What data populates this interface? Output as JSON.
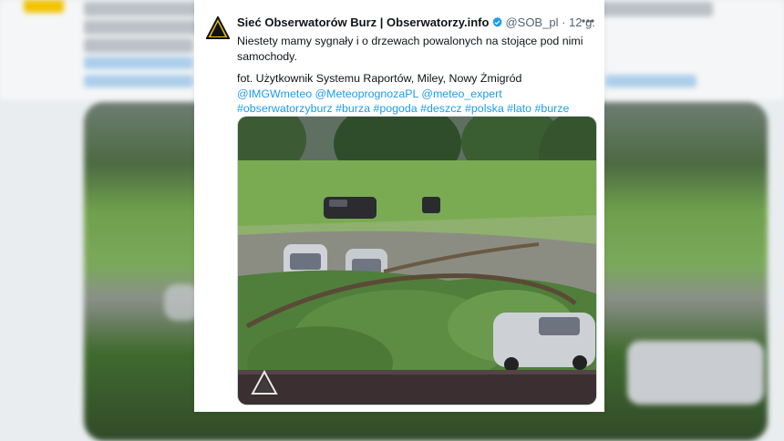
{
  "background": {
    "headline_visible": "Niestety mamy sygnały i o drzewach powalonych na stojące pod nimi samochody."
  },
  "tweet": {
    "author_name": "Sieć Obserwatorów Burz | Obserwatorzy.info",
    "handle": "@SOB_pl",
    "separator": "·",
    "time": "12 g.",
    "more_icon": "more-icon",
    "text_line1": "Niestety mamy sygnały i o drzewach powalonych na stojące pod nimi samochody.",
    "text_line2": "fot. Użytkownik Systemu Raportów, Miley, Nowy Żmigród",
    "mentions": "@IMGWmeteo @MeteoprognozaPL @meteo_expert",
    "hashtags": "#obserwatorzyburz #burza #pogoda #deszcz #polska #lato #burze",
    "image_alt": "Fallen tree on parked cars"
  },
  "colors": {
    "link": "#1d9bf0",
    "text": "#0f1419",
    "muted": "#536471",
    "logo_yellow": "#f2c300"
  }
}
